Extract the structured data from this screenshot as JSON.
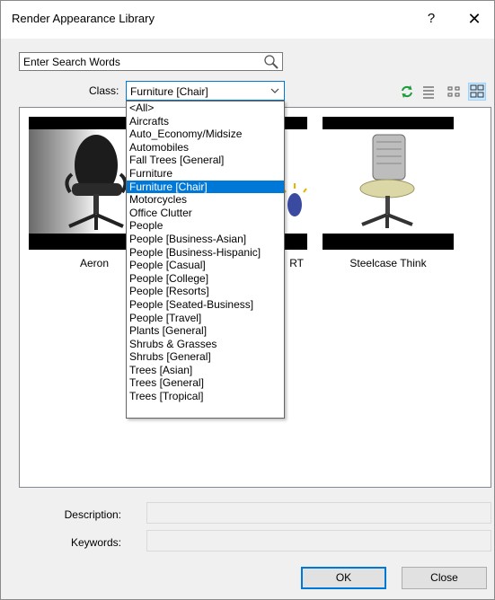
{
  "window": {
    "title": "Render Appearance Library",
    "help_label": "?",
    "close_label": "✕"
  },
  "search": {
    "placeholder": "Enter Search Words",
    "value": ""
  },
  "class_filter": {
    "label": "Class:",
    "selected": "Furniture [Chair]",
    "options": [
      "<All>",
      "Aircrafts",
      "Auto_Economy/Midsize",
      "Automobiles",
      "Fall Trees [General]",
      "Furniture",
      "Furniture [Chair]",
      "Motorcycles",
      "Office Clutter",
      "People",
      "People [Business-Asian]",
      "People [Business-Hispanic]",
      "People [Casual]",
      "People [College]",
      "People [Resorts]",
      "People [Seated-Business]",
      "People [Travel]",
      "Plants [General]",
      "Shrubs & Grasses",
      "Shrubs [General]",
      "Trees [Asian]",
      "Trees [General]",
      "Trees [Tropical]"
    ]
  },
  "toolbar": {
    "icons": [
      "refresh-icon",
      "list-view-icon",
      "small-icons-view-icon",
      "large-icons-view-icon"
    ],
    "active_view": "large-icons-view-icon",
    "refresh_color": "#1a9c3a"
  },
  "items": [
    {
      "label": "Aeron"
    },
    {
      "label": "RT"
    },
    {
      "label": "Steelcase Think"
    }
  ],
  "details": {
    "description_label": "Description:",
    "description_value": "",
    "keywords_label": "Keywords:",
    "keywords_value": ""
  },
  "buttons": {
    "ok_label": "OK",
    "close_label": "Close"
  },
  "colors": {
    "accent": "#0078d7",
    "selection_bg": "#0078d7",
    "dialog_bg": "#f0f0f0"
  }
}
